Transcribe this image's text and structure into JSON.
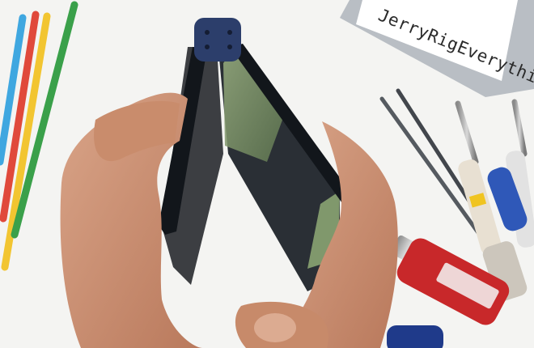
{
  "scene": {
    "description_label": "",
    "label_strip_text": "JerryRigEverything",
    "colors": {
      "background": "#f4f4f2",
      "phone_body": "#1a1f26",
      "hinge_blue": "#2c3e6b",
      "screen_green": "#7f9a6a",
      "skin": "#c99074",
      "lighter_red": "#c8282a",
      "pencil_blue": "#3fa7e0",
      "pencil_red": "#e0493b",
      "pencil_yellow": "#f2c531",
      "pencil_green": "#3aa04a"
    },
    "icons": [
      "folding-phone-icon",
      "hands-icon",
      "tweezers-icon",
      "screwdriver-icon",
      "lighter-icon",
      "pencil-icon"
    ]
  }
}
